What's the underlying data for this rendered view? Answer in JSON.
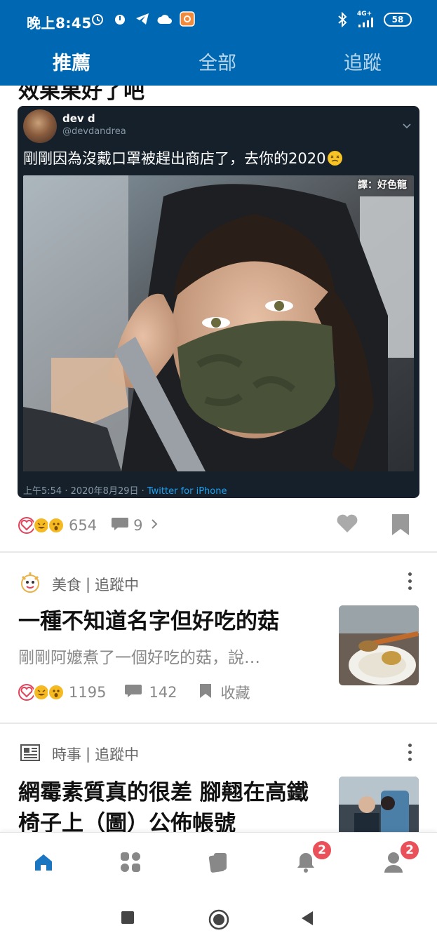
{
  "status_bar": {
    "time": "晚上8:45",
    "network": "4G+",
    "battery": "58"
  },
  "tabs": [
    {
      "label": "推薦",
      "active": true
    },
    {
      "label": "全部",
      "active": false
    },
    {
      "label": "追蹤",
      "active": false
    }
  ],
  "first_post": {
    "title_clipped": "效果果好了吧",
    "tweet": {
      "name": "dev d",
      "handle": "@devdandrea",
      "text": "剛剛因為沒戴口罩被趕出商店了，去你的2020",
      "credit": "譯：好色龍",
      "time": "上午5:54 · 2020年8月29日 · ",
      "source": "Twitter for iPhone"
    },
    "reaction_count": "654",
    "comment_count": "9"
  },
  "posts": [
    {
      "category": "美食",
      "follow": "追蹤中",
      "title": "一種不知道名字但好吃的菇",
      "excerpt": "剛剛阿嬤煮了一個好吃的菇，說…",
      "reaction_count": "1195",
      "comment_count": "142",
      "save_label": "收藏"
    },
    {
      "category": "時事",
      "follow": "追蹤中",
      "title": "網霉素質真的很差 腳翹在高鐵椅子上（圖）公佈帳號"
    }
  ],
  "bottom_nav": {
    "notifications_badge": "2",
    "profile_badge": "2"
  },
  "colors": {
    "brand": "#0068b2",
    "badge": "#e9505a",
    "tweet_bg": "#15202b"
  }
}
